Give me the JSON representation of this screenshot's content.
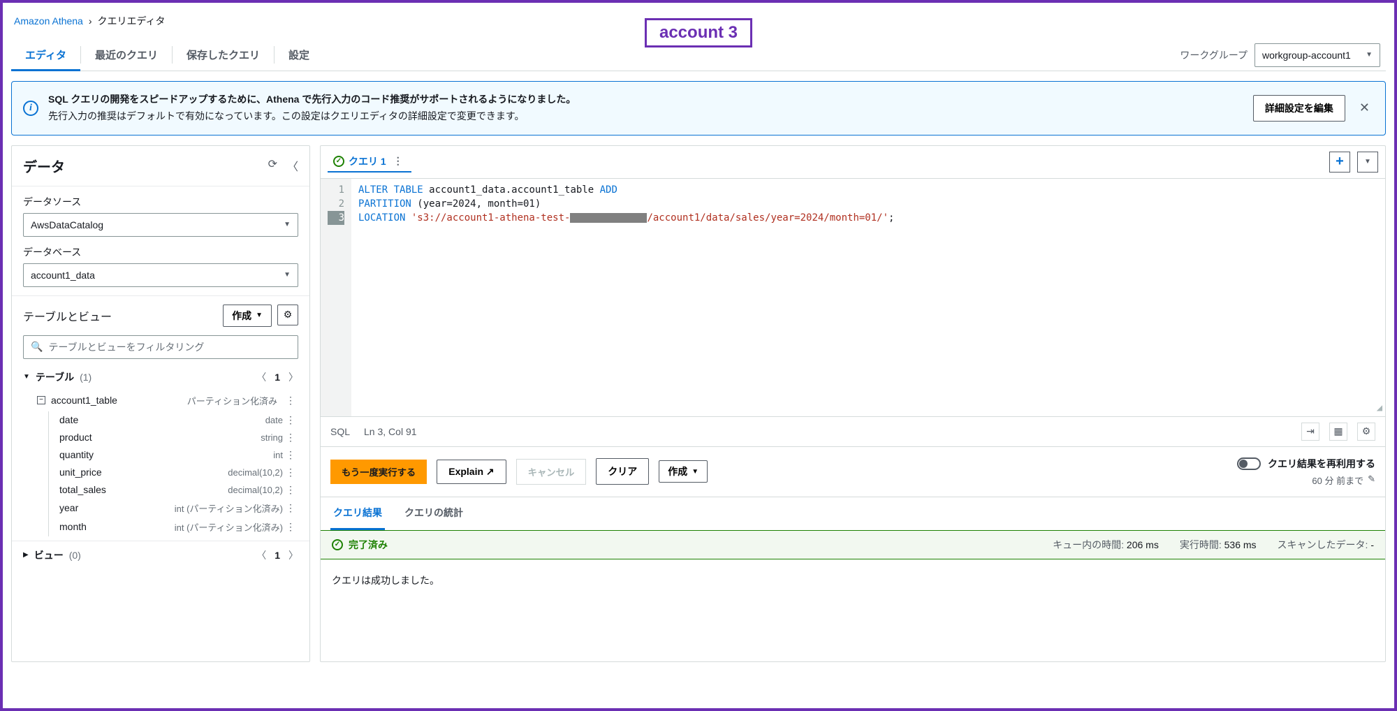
{
  "breadcrumb": {
    "service": "Amazon Athena",
    "page": "クエリエディタ"
  },
  "account_badge": "account 3",
  "nav_tabs": {
    "editor": "エディタ",
    "recent": "最近のクエリ",
    "saved": "保存したクエリ",
    "settings": "設定"
  },
  "workgroup": {
    "label": "ワークグループ",
    "value": "workgroup-account1"
  },
  "banner": {
    "title": "SQL クエリの開発をスピードアップするために、Athena で先行入力のコード推奨がサポートされるようになりました。",
    "body": "先行入力の推奨はデフォルトで有効になっています。この設定はクエリエディタの詳細設定で変更できます。",
    "button": "詳細設定を編集"
  },
  "sidebar": {
    "title": "データ",
    "datasource_label": "データソース",
    "datasource_value": "AwsDataCatalog",
    "database_label": "データベース",
    "database_value": "account1_data",
    "tv_title": "テーブルとビュー",
    "create_btn": "作成",
    "filter_placeholder": "テーブルとビューをフィルタリング",
    "tables_label": "テーブル",
    "tables_count": "(1)",
    "table_name": "account1_table",
    "table_pill": "パーティション化済み",
    "columns": [
      {
        "name": "date",
        "type": "date"
      },
      {
        "name": "product",
        "type": "string"
      },
      {
        "name": "quantity",
        "type": "int"
      },
      {
        "name": "unit_price",
        "type": "decimal(10,2)"
      },
      {
        "name": "total_sales",
        "type": "decimal(10,2)"
      },
      {
        "name": "year",
        "type": "int (パーティション化済み)"
      },
      {
        "name": "month",
        "type": "int (パーティション化済み)"
      }
    ],
    "views_label": "ビュー",
    "views_count": "(0)",
    "page_num": "1"
  },
  "query": {
    "tab_name": "クエリ 1",
    "lines": {
      "l1a": "ALTER",
      "l1b": " TABLE",
      "l1c": " account1_data.account1_table ",
      "l1d": "ADD",
      "l2a": "PARTITION",
      "l2b": " (year=2024, month=01)",
      "l3a": "LOCATION ",
      "l3b": "'s3://account1-athena-test-",
      "l3c": "/account1/data/sales/year=2024/month=01/'",
      "l3d": ";"
    },
    "status_lang": "SQL",
    "status_pos": "Ln 3, Col 91"
  },
  "actions": {
    "run_again": "もう一度実行する",
    "explain": "Explain",
    "cancel": "キャンセル",
    "clear": "クリア",
    "create": "作成",
    "reuse_label": "クエリ結果を再利用する",
    "reuse_sub": "60 分 前まで"
  },
  "results": {
    "tab_results": "クエリ結果",
    "tab_stats": "クエリの統計",
    "status": "完了済み",
    "queued_label": "キュー内の時間:",
    "queued_value": "206 ms",
    "runtime_label": "実行時間:",
    "runtime_value": "536 ms",
    "scanned_label": "スキャンしたデータ:",
    "scanned_value": "-",
    "message": "クエリは成功しました。"
  }
}
